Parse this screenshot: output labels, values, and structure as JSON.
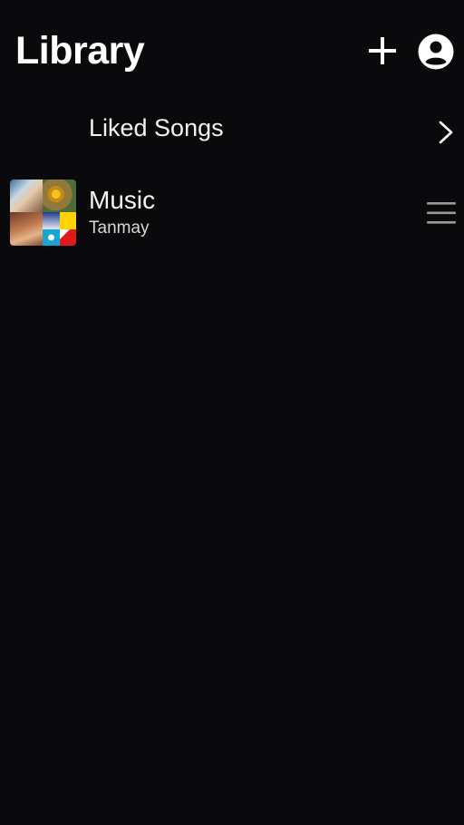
{
  "header": {
    "title": "Library",
    "add_icon": "plus-icon",
    "account_icon": "account-circle-icon"
  },
  "library": {
    "liked_songs": {
      "label": "Liked Songs",
      "icon": "chevron-right-icon"
    },
    "playlists": [
      {
        "title": "Music",
        "owner": "Tanmay",
        "cover": "playlist-cover-mosaic",
        "handle_icon": "drag-handle-icon"
      }
    ]
  },
  "colors": {
    "background": "#0a0a0c",
    "text_primary": "#ffffff",
    "text_secondary": "#d6d6d6",
    "icon_muted": "#9a9a9a"
  }
}
